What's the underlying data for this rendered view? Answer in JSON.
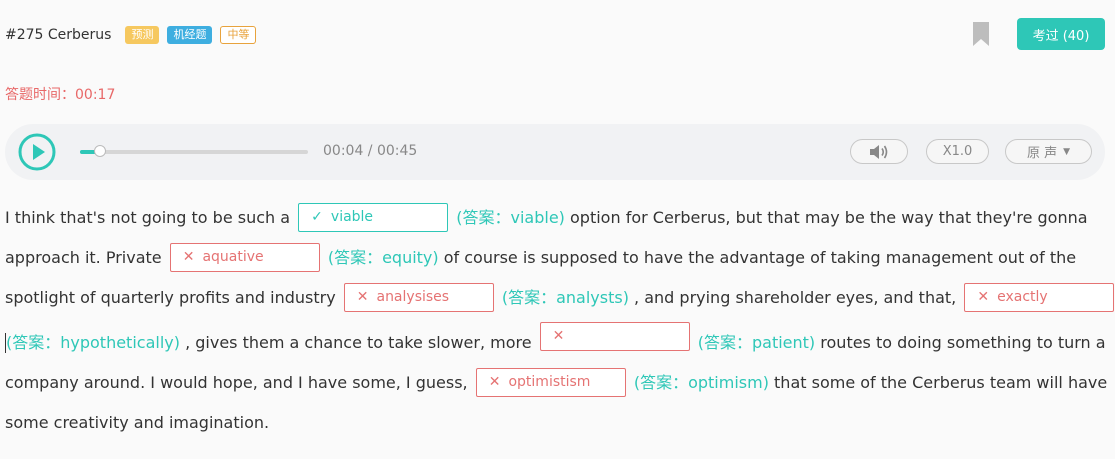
{
  "header": {
    "title": "#275 Cerberus",
    "tags": [
      "预测",
      "机经题",
      "中等"
    ],
    "kaoguo_label": "考过 (40)"
  },
  "timer": {
    "label": "答题时间：",
    "value": "00:17"
  },
  "player": {
    "current": "00:04",
    "total": "00:45",
    "time_display": "00:04 / 00:45",
    "progress_fraction": 0.089,
    "speed": "X1.0",
    "voice": "原 声"
  },
  "colors": {
    "accent": "#2ec7b7",
    "error": "#e57373",
    "timer": "#e86868"
  },
  "passage": {
    "l1_a": "I think that's not going to be such a",
    "b1": {
      "mark": "✓",
      "value": "viable",
      "correct": true
    },
    "a1": "(答案：viable)",
    "l1_b": "option for Cerberus, but that may be the way that they're gonna",
    "l2_a": "approach it. Private",
    "b2": {
      "mark": "✕",
      "value": "aquative",
      "correct": false
    },
    "a2": "(答案：equity)",
    "l2_b": "of course is supposed to have the advantage of taking management out of the",
    "l3_a": "spotlight of quarterly profits and industry",
    "b3": {
      "mark": "✕",
      "value": "analysises",
      "correct": false
    },
    "a3": "(答案：analysts)",
    "l3_b": ", and prying shareholder eyes, and that,",
    "b4": {
      "mark": "✕",
      "value": "exactly",
      "correct": false
    },
    "a4": "(答案：hypothetically)",
    "l4_a": ", gives them a chance to take slower, more",
    "b5": {
      "mark": "✕",
      "value": "",
      "correct": false
    },
    "a5": "(答案：patient)",
    "l4_b": "routes to doing something to turn a",
    "l5_a": "company around. I would hope, and I have some, I guess,",
    "b6": {
      "mark": "✕",
      "value": "optimistism",
      "correct": false
    },
    "a6": "(答案：optimism)",
    "l5_b": "that some of the Cerberus team will have",
    "l6": "some creativity and imagination."
  }
}
